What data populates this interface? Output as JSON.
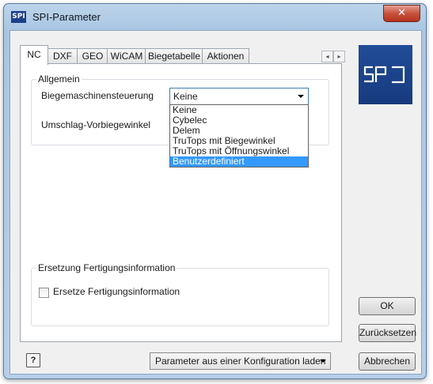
{
  "window": {
    "title": "SPI-Parameter",
    "icon_text": "SPI",
    "close_glyph": "✕"
  },
  "tabs": [
    {
      "label": "NC",
      "active": true
    },
    {
      "label": "DXF"
    },
    {
      "label": "GEO"
    },
    {
      "label": "WiCAM"
    },
    {
      "label": "Biegetabelle"
    },
    {
      "label": "Aktionen"
    }
  ],
  "tab_scroll": {
    "left": "◂",
    "right": "▸"
  },
  "allgemein": {
    "title": "Allgemein",
    "steuerung_label": "Biegemaschinensteuerung",
    "steuerung_value": "Keine",
    "vorbiegewinkel_label": "Umschlag-Vorbiegewinkel",
    "options": [
      "Keine",
      "Cybelec",
      "Delem",
      "TruTops mit Biegewinkel",
      "TruTops mit Öffnungswinkel",
      "Benutzerdefiniert"
    ],
    "highlighted_option": "Benutzerdefiniert"
  },
  "ersetzung": {
    "title": "Ersetzung Fertigungsinformation",
    "checkbox_label": "Ersetze Fertigungsinformation",
    "checked": false
  },
  "buttons": {
    "ok": "OK",
    "reset": "Zurücksetzen",
    "cancel": "Abbrechen",
    "help": "?",
    "load_config": "Parameter aus einer Konfiguration laden"
  },
  "colors": {
    "logo_bg": "#1d4690",
    "selection": "#3399ff",
    "close_button": "#c7513c"
  },
  "icons": {
    "app": "spi-app-icon",
    "close": "close-icon",
    "help": "help-icon",
    "logo": "spi-logo"
  }
}
